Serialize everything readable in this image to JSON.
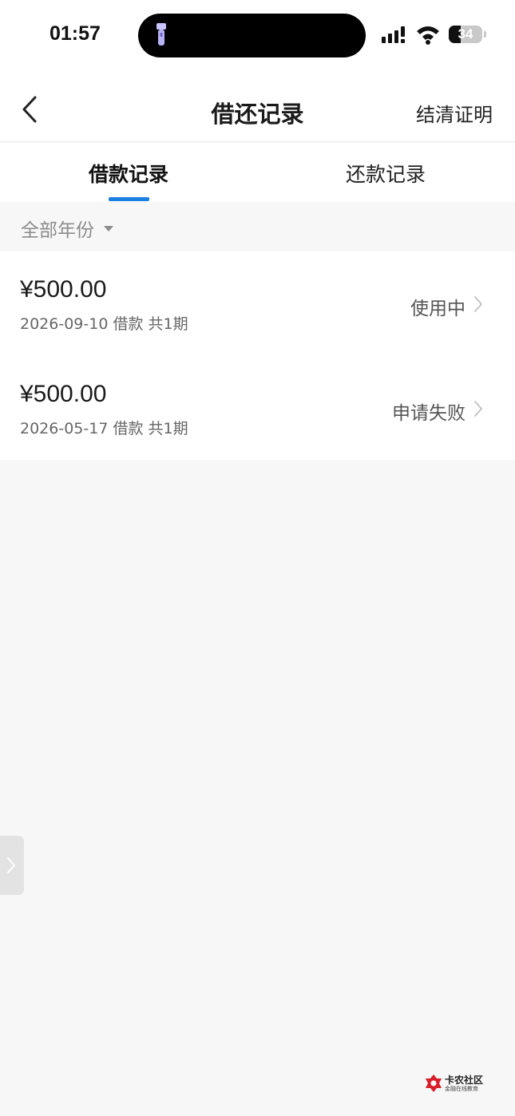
{
  "status_bar": {
    "time": "01:57",
    "battery": "34"
  },
  "nav": {
    "title": "借还记录",
    "right_action": "结清证明"
  },
  "tabs": [
    {
      "label": "借款记录",
      "active": true
    },
    {
      "label": "还款记录",
      "active": false
    }
  ],
  "filter": {
    "label": "全部年份"
  },
  "records": [
    {
      "amount": "¥500.00",
      "meta": "2026-09-10 借款 共1期",
      "status": "使用中"
    },
    {
      "amount": "¥500.00",
      "meta": "2026-05-17 借款 共1期",
      "status": "申请失败"
    }
  ],
  "watermark": {
    "name": "卡农社区",
    "subtitle": "金融在线教育"
  },
  "colors": {
    "accent": "#1b7fe0",
    "background": "#f7f7f7"
  }
}
